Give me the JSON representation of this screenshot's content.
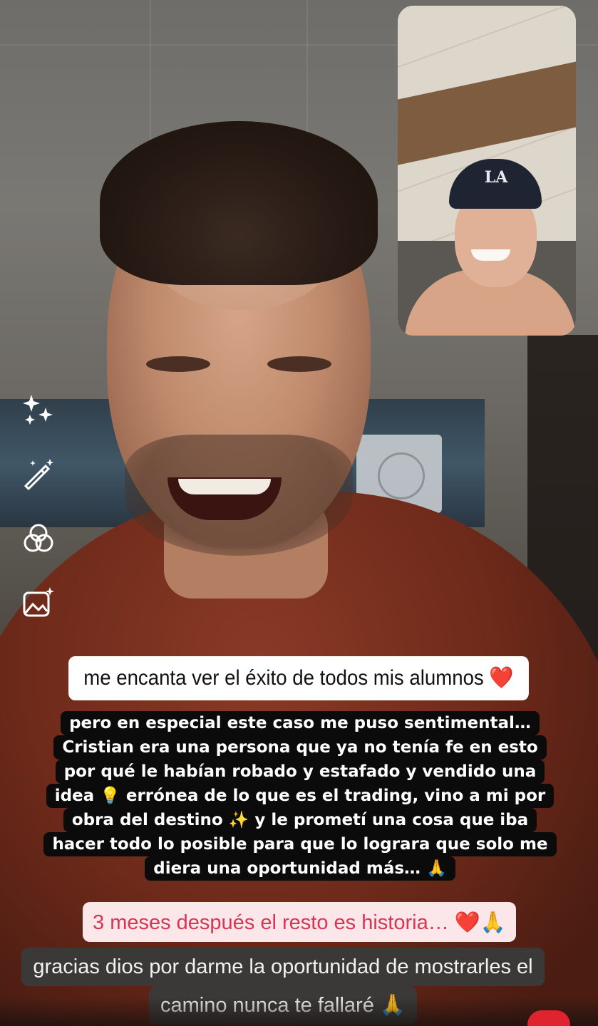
{
  "story": {
    "captions": {
      "white": {
        "text": "me encanta ver el éxito de todos mis alumnos",
        "emoji": "❤️"
      },
      "black": {
        "lines": [
          "pero en especial este caso me puso sentimental…",
          "Cristian era una persona que ya no tenía fe en esto",
          "por qué le habían robado y estafado y vendido una",
          "idea 💡 errónea de lo que es el trading, vino a mi por",
          "obra del destino ✨ y le prometí una cosa que iba",
          "hacer todo lo posible para que lo lograra que solo me",
          "diera una oportunidad más… 🙏"
        ]
      },
      "pink": {
        "text": "3 meses después el resto es historia…",
        "emoji": "❤️🙏"
      },
      "dark": {
        "lines": [
          "gracias dios por darme la oportunidad de mostrarles el",
          "camino nunca te fallaré 🙏"
        ]
      }
    },
    "tools": [
      {
        "name": "sparkles-icon"
      },
      {
        "name": "magic-wand-icon"
      },
      {
        "name": "filter-icon"
      },
      {
        "name": "image-sparkle-icon"
      }
    ],
    "colors": {
      "pink_text": "#d63653",
      "pink_bg": "#fbe6ea",
      "heart": "#e0242f",
      "cap_logo": "LA"
    }
  }
}
